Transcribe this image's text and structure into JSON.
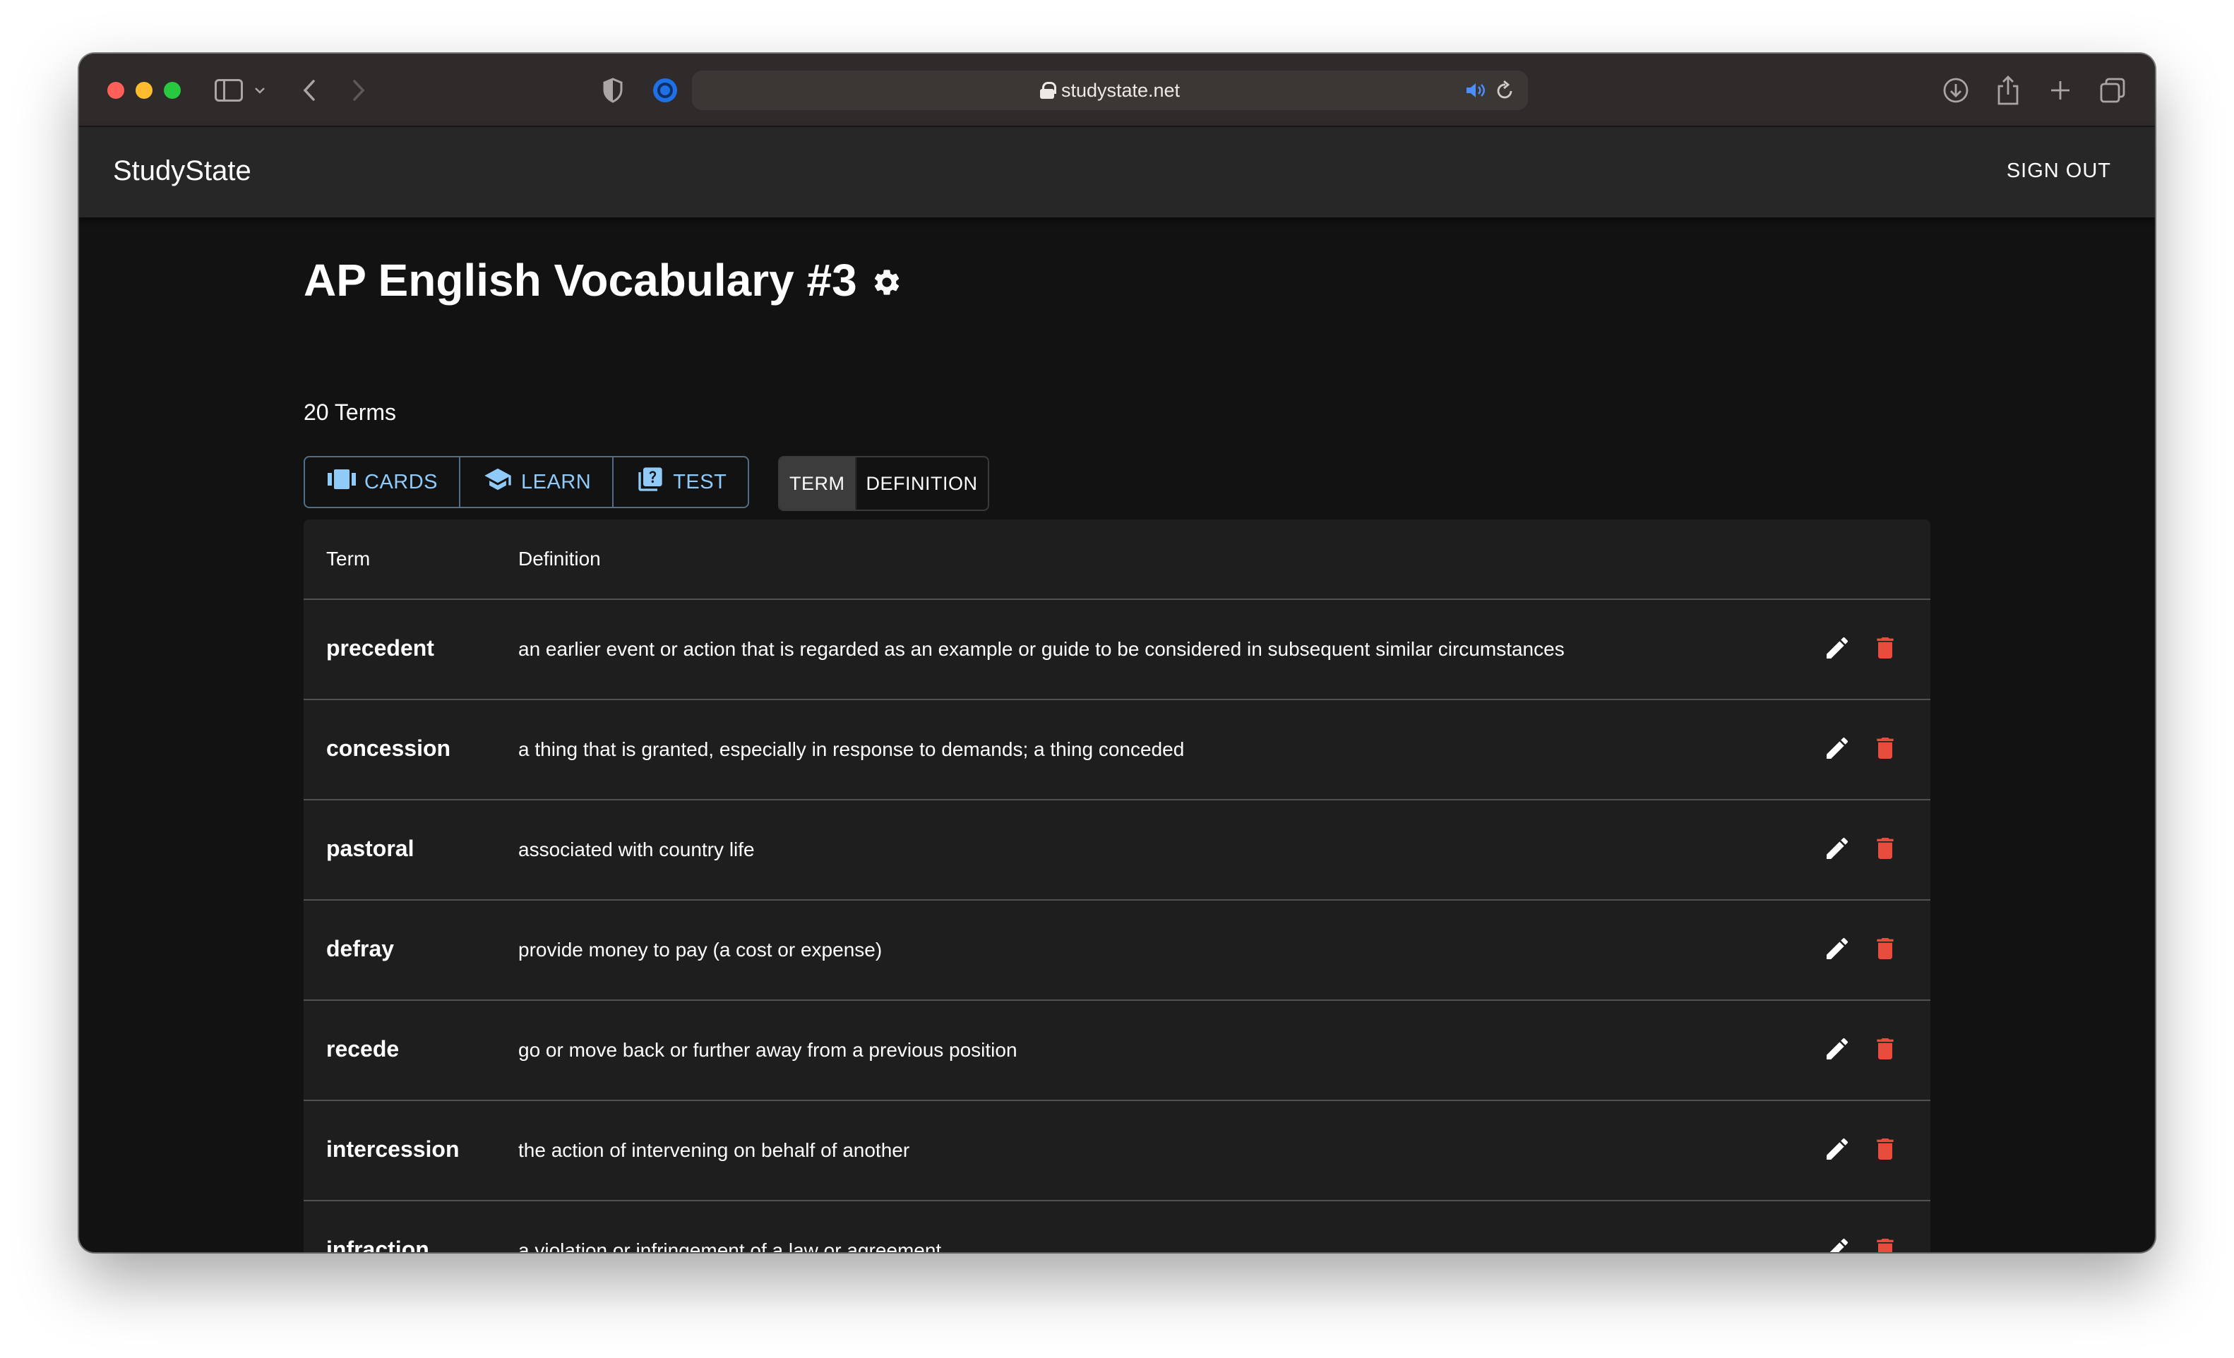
{
  "browser": {
    "url": "studystate.net",
    "icons": [
      "sidebar-icon",
      "chevron-down-icon",
      "back-icon",
      "forward-icon",
      "shield-icon",
      "extension-icon",
      "lock-icon",
      "speaker-icon",
      "reload-icon",
      "download-icon",
      "share-icon",
      "plus-icon",
      "tabs-icon"
    ]
  },
  "appbar": {
    "brand": "StudyState",
    "signout_label": "SIGN OUT"
  },
  "set": {
    "title": "AP English Vocabulary #3",
    "term_count": "20 Terms"
  },
  "modes": [
    {
      "label": "CARDS",
      "icon": "cards-icon"
    },
    {
      "label": "LEARN",
      "icon": "graduation-cap-icon"
    },
    {
      "label": "TEST",
      "icon": "quiz-icon"
    }
  ],
  "sort_toggle": {
    "term_label": "TERM",
    "definition_label": "DEFINITION",
    "selected": "TERM"
  },
  "table": {
    "headers": {
      "term": "Term",
      "definition": "Definition"
    },
    "rows": [
      {
        "term": "precedent",
        "definition": "an earlier event or action that is regarded as an example or guide to be considered in subsequent similar circumstances"
      },
      {
        "term": "concession",
        "definition": "a thing that is granted, especially in response to demands; a thing conceded"
      },
      {
        "term": "pastoral",
        "definition": "associated with country life"
      },
      {
        "term": "defray",
        "definition": "provide money to pay (a cost or expense)"
      },
      {
        "term": "recede",
        "definition": "go or move back or further away from a previous position"
      },
      {
        "term": "intercession",
        "definition": "the action of intervening on behalf of another"
      },
      {
        "term": "infraction",
        "definition": "a violation or infringement of a law or agreement"
      }
    ]
  },
  "colors": {
    "accent": "#90caf9",
    "delete": "#e74c3c",
    "background": "#121212",
    "surface": "#1e1e1e",
    "appbar": "#272727"
  }
}
